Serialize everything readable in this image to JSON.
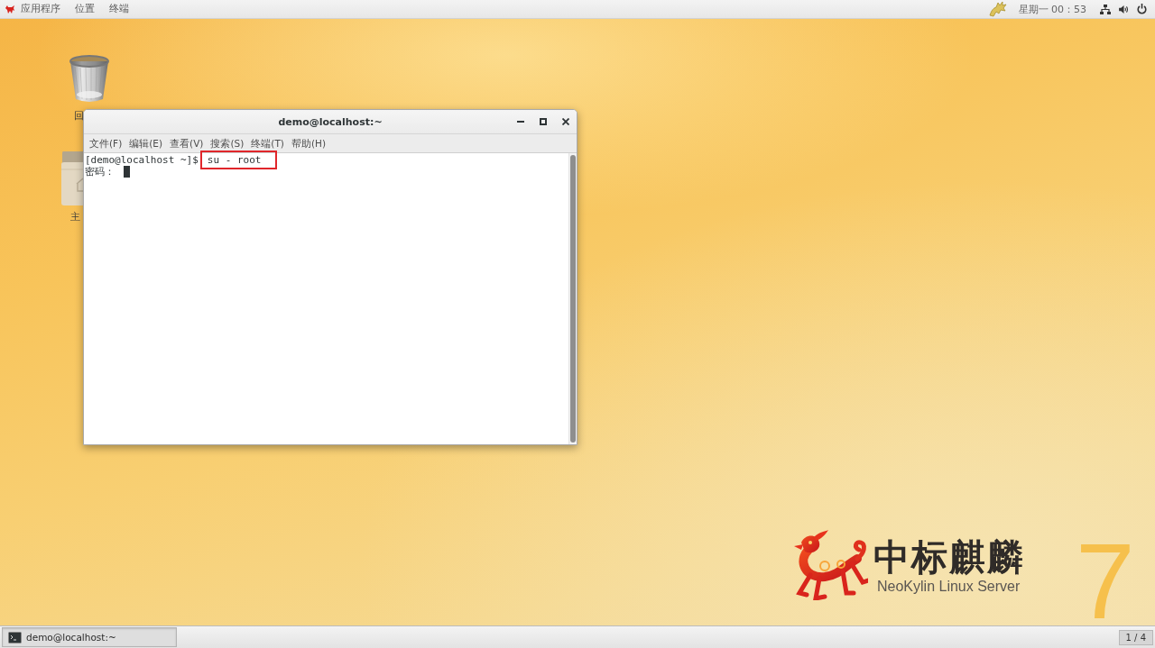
{
  "top_bar": {
    "app_menu": {
      "label": "应用程序"
    },
    "menus": [
      {
        "label": "位置"
      },
      {
        "label": "终端"
      }
    ],
    "clock": "星期一 00：53"
  },
  "desktop_icons": [
    {
      "kind": "trash",
      "label": "回"
    },
    {
      "kind": "folder",
      "label": "主"
    }
  ],
  "window": {
    "title": "demo@localhost:~",
    "menu": [
      "文件(F)",
      "编辑(E)",
      "查看(V)",
      "搜索(S)",
      "终端(T)",
      "帮助(H)"
    ],
    "terminal": {
      "lines": [
        {
          "prompt": "[demo@localhost ~]$",
          "command": "su - root",
          "highlighted": true,
          "cursor": false
        },
        {
          "prompt": "密码：",
          "highlighted": false,
          "cursor": true
        }
      ]
    }
  },
  "wallpaper": {
    "logo_title": "中标麒麟",
    "logo_subtitle": "NeoKylin Linux Server",
    "version": "7"
  },
  "taskbar": {
    "tasks": [
      {
        "label": "demo@localhost:~",
        "selected": true
      }
    ],
    "workspace": "1 / 4"
  }
}
